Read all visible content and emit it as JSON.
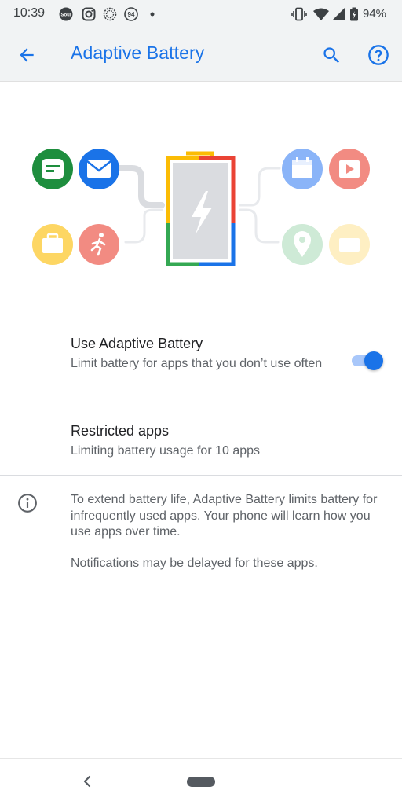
{
  "status_bar": {
    "time": "10:39",
    "battery_percent": "94%",
    "notification_icons": [
      "soul-app-icon",
      "instagram-icon",
      "spinner-app-icon",
      "badge-94-icon",
      "dot-icon"
    ],
    "system_icons": [
      "vibrate-icon",
      "wifi-icon",
      "cellular-signal-icon",
      "battery-icon"
    ]
  },
  "app_bar": {
    "title": "Adaptive Battery",
    "accent_color": "#1a73e8"
  },
  "hero": {
    "left_app_icons": [
      "messages-icon",
      "mail-icon",
      "briefcase-icon",
      "fitness-icon"
    ],
    "right_app_icons": [
      "calendar-icon",
      "video-icon",
      "maps-icon",
      "card-icon"
    ],
    "center_icon": "battery-lightning-icon"
  },
  "settings": [
    {
      "title": "Use Adaptive Battery",
      "summary": "Limit battery for apps that you don’t use often",
      "toggle_on": true
    },
    {
      "title": "Restricted apps",
      "summary": "Limiting battery usage for 10 apps"
    }
  ],
  "footer": {
    "paragraph_1": "To extend battery life, Adaptive Battery limits battery for infrequently used apps. Your phone will learn how you use apps over time.",
    "paragraph_2": "Notifications may be delayed for these apps."
  }
}
